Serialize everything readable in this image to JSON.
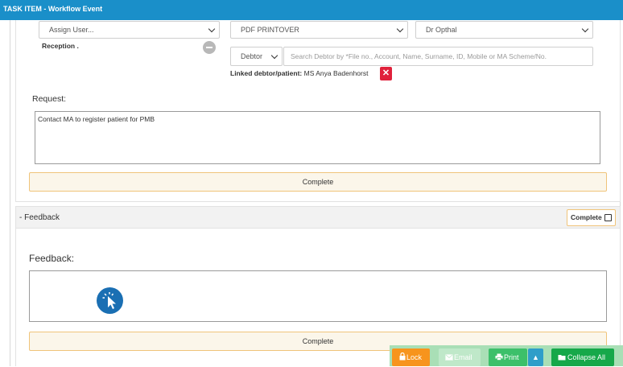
{
  "window": {
    "title": "TASK ITEM - Workflow Event"
  },
  "assign": {
    "user_select": "Assign User...",
    "group_label": "Reception ."
  },
  "print": {
    "template_select": "PDF PRINTOVER"
  },
  "doctor": {
    "select": "Dr Opthal"
  },
  "debtor": {
    "type_select": "Debtor",
    "search_placeholder": "Search Debtor by *File no., Account, Name, Surname, ID, Mobile or MA Scheme/No.",
    "linked_label": "Linked debtor/patient:",
    "linked_value": "MS Anya Badenhorst"
  },
  "request": {
    "label": "Request:",
    "text": "Contact MA to register patient for PMB",
    "complete_label": "Complete"
  },
  "feedback": {
    "section_title": "- Feedback",
    "header_complete_label": "Complete",
    "label": "Feedback:",
    "text": "",
    "complete_label": "Complete"
  },
  "footer": {
    "lock_label": "Lock",
    "email_label": "Email",
    "print_label": "Print",
    "collapse_label": "Collapse All"
  },
  "colors": {
    "titlebar": "#1a8fc9",
    "lock": "#f7941d",
    "print": "#3cc06a",
    "collapse": "#16a84a",
    "complete_border": "#f0c47a",
    "remove": "#e0213b"
  }
}
